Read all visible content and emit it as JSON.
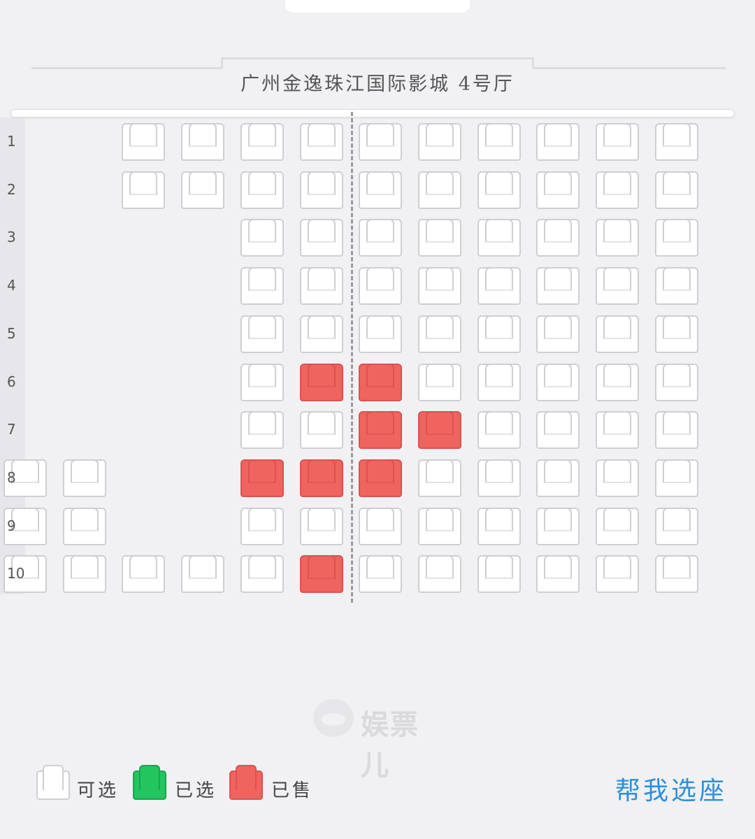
{
  "hall": {
    "title": "广州金逸珠江国际影城 4号厅"
  },
  "rows": [
    {
      "label": "1",
      "seats": [
        "",
        "",
        "a",
        "a",
        "a",
        "a",
        "a",
        "a",
        "a",
        "a",
        "a",
        "a"
      ]
    },
    {
      "label": "2",
      "seats": [
        "",
        "",
        "a",
        "a",
        "a",
        "a",
        "a",
        "a",
        "a",
        "a",
        "a",
        "a"
      ]
    },
    {
      "label": "3",
      "seats": [
        "",
        "",
        "",
        "",
        "a",
        "a",
        "a",
        "a",
        "a",
        "a",
        "a",
        "a"
      ]
    },
    {
      "label": "4",
      "seats": [
        "",
        "",
        "",
        "",
        "a",
        "a",
        "a",
        "a",
        "a",
        "a",
        "a",
        "a"
      ]
    },
    {
      "label": "5",
      "seats": [
        "",
        "",
        "",
        "",
        "a",
        "a",
        "a",
        "a",
        "a",
        "a",
        "a",
        "a"
      ]
    },
    {
      "label": "6",
      "seats": [
        "",
        "",
        "",
        "",
        "a",
        "s",
        "s",
        "a",
        "a",
        "a",
        "a",
        "a"
      ]
    },
    {
      "label": "7",
      "seats": [
        "",
        "",
        "",
        "",
        "a",
        "a",
        "s",
        "s",
        "a",
        "a",
        "a",
        "a"
      ]
    },
    {
      "label": "8",
      "seats": [
        "a",
        "a",
        "",
        "",
        "s",
        "s",
        "s",
        "a",
        "a",
        "a",
        "a",
        "a"
      ]
    },
    {
      "label": "9",
      "seats": [
        "a",
        "a",
        "",
        "",
        "a",
        "a",
        "a",
        "a",
        "a",
        "a",
        "a",
        "a"
      ]
    },
    {
      "label": "10",
      "seats": [
        "a",
        "a",
        "a",
        "a",
        "a",
        "s",
        "a",
        "a",
        "a",
        "a",
        "a",
        "a"
      ]
    }
  ],
  "seat_states": {
    "a": "available",
    "s": "sold"
  },
  "legend": {
    "available_label": "可选",
    "selected_label": "已选",
    "sold_label": "已售"
  },
  "colors": {
    "available": "#ffffff",
    "selected": "#22c55e",
    "sold": "#f06460",
    "accent": "#2b8fdc"
  },
  "watermark": {
    "text": "娱票儿"
  },
  "actions": {
    "help_choose_label": "帮我选座"
  }
}
